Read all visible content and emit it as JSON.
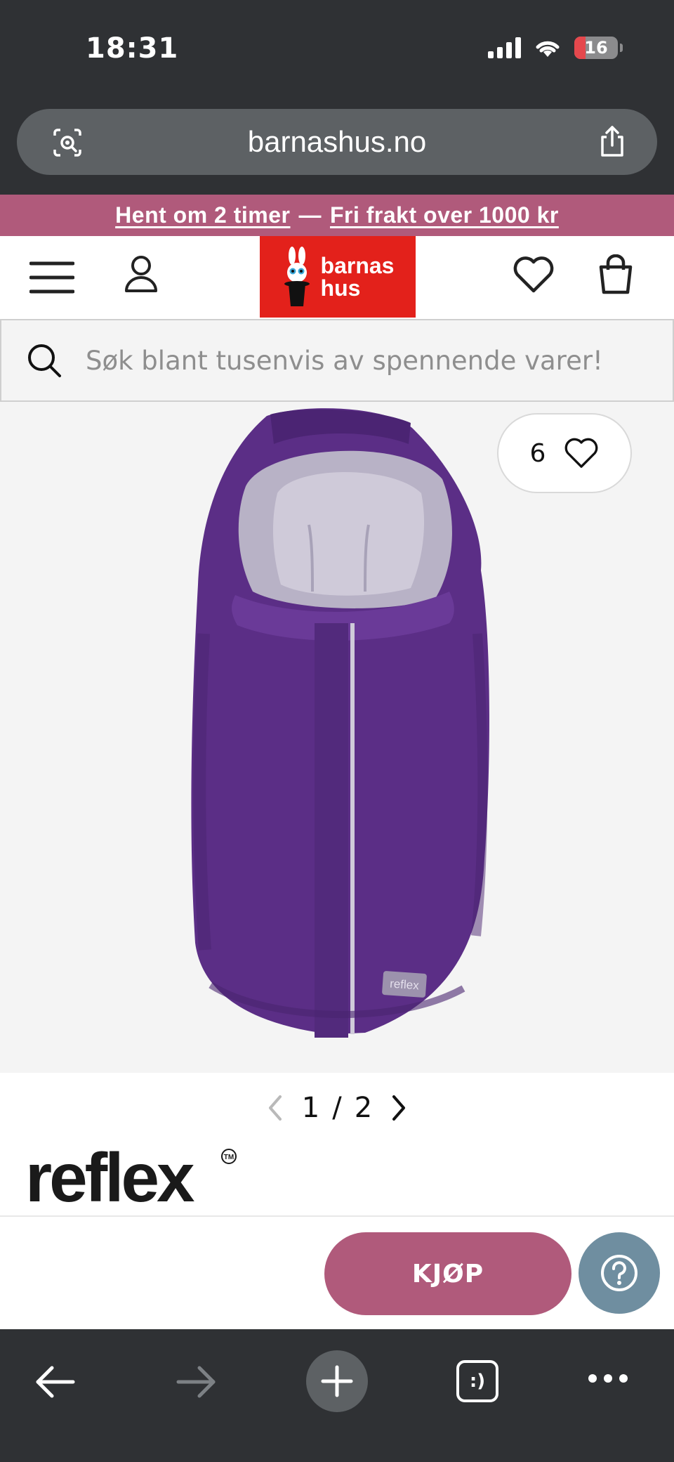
{
  "status_bar": {
    "time": "18:31",
    "battery_level": "16",
    "icons": [
      "signal-icon",
      "wifi-icon",
      "battery-icon"
    ]
  },
  "browser": {
    "url": "barnashus.no",
    "left_icon": "camera-search-icon",
    "right_icon": "share-icon"
  },
  "promo": {
    "link1": "Hent om 2 timer",
    "separator": "—",
    "link2": "Fri frakt over 1000 kr",
    "color": "#b05a7b"
  },
  "header": {
    "logo_line1": "barnas",
    "logo_line2": "hus",
    "logo_color": "#e3211b",
    "icons": [
      "menu-icon",
      "user-icon",
      "heart-icon",
      "bag-icon"
    ]
  },
  "search": {
    "placeholder": "Søk blant tusenvis av spennende varer!"
  },
  "product": {
    "favorite_count": "6",
    "label": "reflex",
    "pager_current": "1",
    "pager_separator": "/",
    "pager_total": "2"
  },
  "brand": {
    "name": "reflex",
    "mark": "TM"
  },
  "actions": {
    "buy_label": "KJØP",
    "help_icon": "question-icon",
    "buy_color": "#b05a7b",
    "help_color": "#6f8ea0"
  },
  "bottom_bar": {
    "icons": [
      "back-arrow-icon",
      "forward-arrow-icon",
      "plus-icon",
      "tabs-icon",
      "more-icon"
    ],
    "tabs_glyph": ":)"
  }
}
